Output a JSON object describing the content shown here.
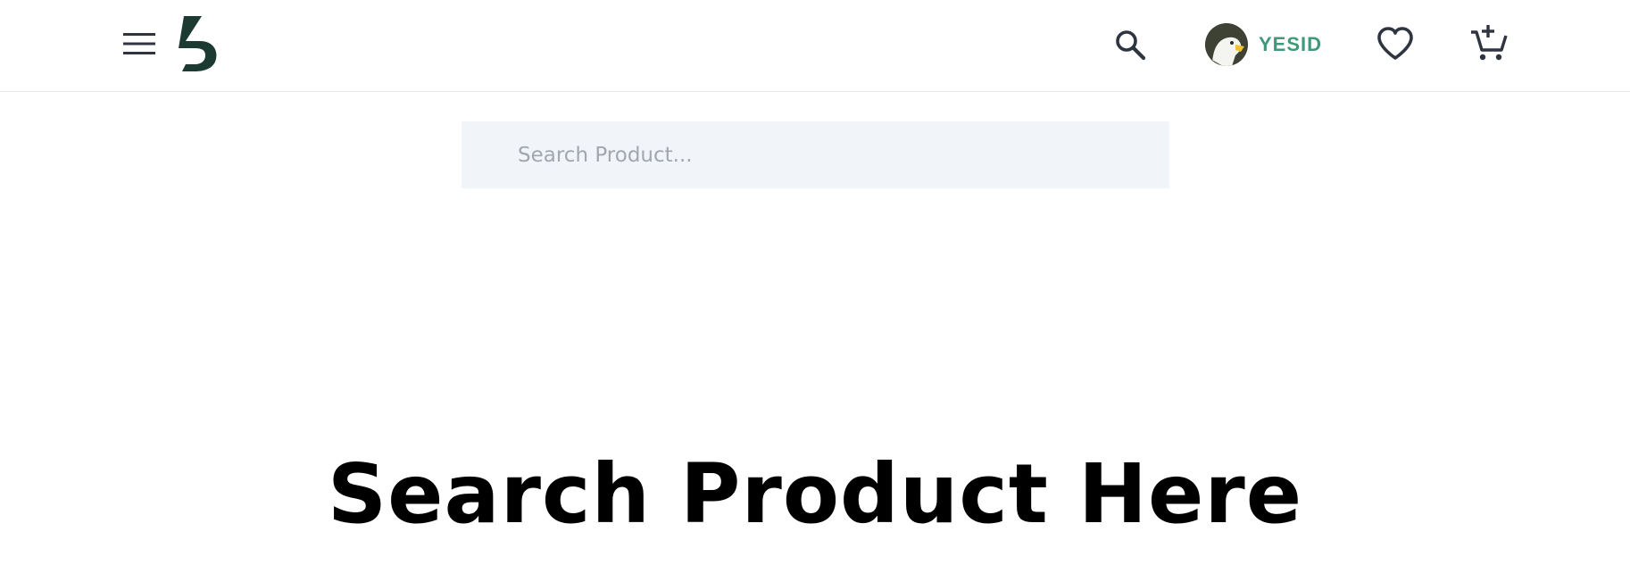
{
  "header": {
    "menu_icon": "hamburger-menu-icon",
    "logo_icon": "brand-s-logo",
    "search_icon": "search-icon",
    "user": {
      "name": "YESID",
      "avatar": "eagle-avatar"
    },
    "wishlist_icon": "heart-icon",
    "cart_icon": "cart-add-icon"
  },
  "search": {
    "placeholder": "Search Product...",
    "value": ""
  },
  "main": {
    "heading": "Search Product Here"
  },
  "colors": {
    "brand_dark": "#1d3a32",
    "accent_green": "#3f9a7a",
    "icon_dark": "#2f3441",
    "search_bg": "#f1f4f8",
    "placeholder": "#a2a7ad"
  }
}
